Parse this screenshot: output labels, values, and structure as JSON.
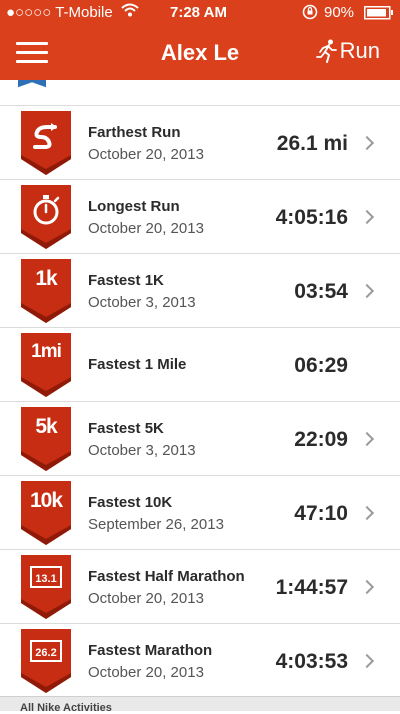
{
  "status_bar": {
    "carrier": "●○○○○ T-Mobile",
    "time": "7:28 AM",
    "battery": "90%"
  },
  "nav": {
    "title": "Alex Le",
    "run_label": "Run"
  },
  "records": [
    {
      "badge": "road",
      "title": "Farthest Run",
      "date": "October 20, 2013",
      "value": "26.1 mi",
      "chevron": true
    },
    {
      "badge": "stopwatch",
      "title": "Longest Run",
      "date": "October 20, 2013",
      "value": "4:05:16",
      "chevron": true
    },
    {
      "badge_text": "1k",
      "title": "Fastest 1K",
      "date": "October 3, 2013",
      "value": "03:54",
      "chevron": true
    },
    {
      "badge_text": "1mi",
      "title": "Fastest 1 Mile",
      "date": "",
      "value": "06:29",
      "chevron": false
    },
    {
      "badge_text": "5k",
      "title": "Fastest 5K",
      "date": "October 3, 2013",
      "value": "22:09",
      "chevron": true
    },
    {
      "badge_text": "10k",
      "title": "Fastest 10K",
      "date": "September 26, 2013",
      "value": "47:10",
      "chevron": true
    },
    {
      "badge_label": "13.1",
      "title": "Fastest Half Marathon",
      "date": "October 20, 2013",
      "value": "1:44:57",
      "chevron": true
    },
    {
      "badge_label": "26.2",
      "title": "Fastest Marathon",
      "date": "October 20, 2013",
      "value": "4:03:53",
      "chevron": true
    }
  ],
  "bottom_bar": {
    "partial_text": "All Nike   Activities"
  },
  "colors": {
    "nav_red": "#d9401b",
    "badge_red": "#c62d12",
    "badge_dark": "#8e1a07"
  }
}
